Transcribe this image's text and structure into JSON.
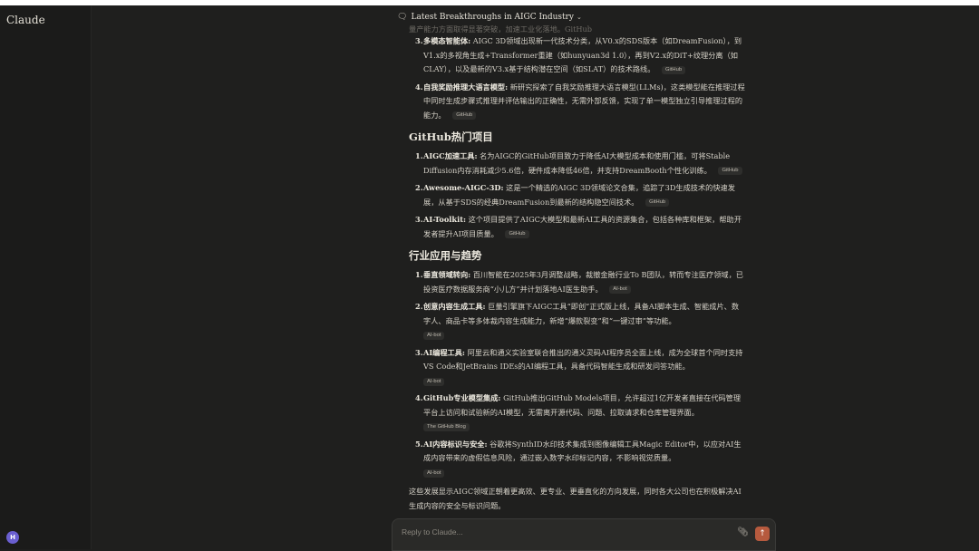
{
  "sidebar": {
    "brand": "Claude",
    "avatar_initial": "H"
  },
  "header": {
    "title": "Latest Breakthroughs in AIGC Industry",
    "title_icon": "chat-bubbles-icon",
    "dropdown_icon": "chevron-down-icon"
  },
  "content": {
    "faded_line": "量产能力方面取得显著突破，加速工业化落地。GitHub",
    "research_items": [
      {
        "num": "3.",
        "title": "多模态智能体:",
        "text": "AIGC 3D领域出现新一代技术分类，从V0.x的SDS版本（如DreamFusion），到V1.x的多视角生成+Transformer重建（如hunyuan3d 1.0），再到V2.x的DiT+纹理分离（如CLAY），以及最新的V3.x基于结构潜在空间（如SLAT）的技术路线。",
        "tag": "GitHub"
      },
      {
        "num": "4.",
        "title": "自我奖励推理大语言模型:",
        "text": "新研究探索了自我奖励推理大语言模型(LLMs)，这类模型能在推理过程中同时生成步骤式推理并评估输出的正确性，无需外部反馈，实现了单一模型独立引导推理过程的能力。",
        "tag": "GitHub"
      }
    ],
    "github_heading": "GitHub热门项目",
    "github_items": [
      {
        "num": "1.",
        "title": "AIGC加速工具:",
        "text": "名为AIGC的GitHub项目致力于降低AI大模型成本和使用门槛，可将Stable Diffusion内存消耗减少5.6倍，硬件成本降低46倍，并支持DreamBooth个性化训练。",
        "tag": "GitHub"
      },
      {
        "num": "2.",
        "title": "Awesome-AIGC-3D:",
        "text": "这是一个精选的AIGC 3D领域论文合集，追踪了3D生成技术的快速发展，从基于SDS的经典DreamFusion到最新的结构隐空间技术。",
        "tag": "GitHub"
      },
      {
        "num": "3.",
        "title": "AI-Toolkit:",
        "text": "这个项目提供了AIGC大模型和最新AI工具的资源集合，包括各种库和框架，帮助开发者提升AI项目质量。",
        "tag": "GitHub"
      }
    ],
    "industry_heading": "行业应用与趋势",
    "industry_items": [
      {
        "num": "1.",
        "title": "垂直领域转向:",
        "text": "百川智能在2025年3月调整战略，裁撤金融行业To B团队，转而专注医疗领域，已投资医疗数据服务商“小儿方”并计划落地AI医生助手。",
        "tag": "AI-bot"
      },
      {
        "num": "2.",
        "title": "创意内容生成工具:",
        "text": "巨量引擎旗下AIGC工具“即创”正式版上线，具备AI脚本生成、智能成片、数字人、商品卡等多体裁内容生成能力，新增“爆款裂变”和“一键过审”等功能。",
        "tag": "AI-bot"
      },
      {
        "num": "3.",
        "title": "AI编程工具:",
        "text": "阿里云和通义实验室联合推出的通义灵码AI程序员全面上线，成为全球首个同时支持VS Code和JetBrains IDEs的AI编程工具，具备代码智能生成和研发问答功能。",
        "tag": "AI-bot"
      },
      {
        "num": "4.",
        "title": "GitHub专业模型集成:",
        "text": "GitHub推出GitHub Models项目，允许超过1亿开发者直接在代码管理平台上访问和试验新的AI模型，无需离开源代码、问题、拉取请求和仓库管理界面。",
        "tag": "The GitHub Blog"
      },
      {
        "num": "5.",
        "title": "AI内容标识与安全:",
        "text": "谷歌将SynthID水印技术集成到图像编辑工具Magic Editor中，以应对AI生成内容带来的虚假信息风险，通过嵌入数字水印标记内容，不影响视觉质量。",
        "tag": "AI-bot"
      }
    ],
    "closing": "这些发展显示AIGC领域正朝着更高效、更专业、更垂直化的方向发展，同时各大公司也在积极解决AI生成内容的安全与标识问题。"
  },
  "input": {
    "placeholder": "Reply to Claude...",
    "attach_icon": "paperclip-icon",
    "send_icon": "arrow-up-icon"
  },
  "colors": {
    "background": "#1f1f1e",
    "send_button": "#b65a3e",
    "avatar": "#6a5fd0"
  }
}
